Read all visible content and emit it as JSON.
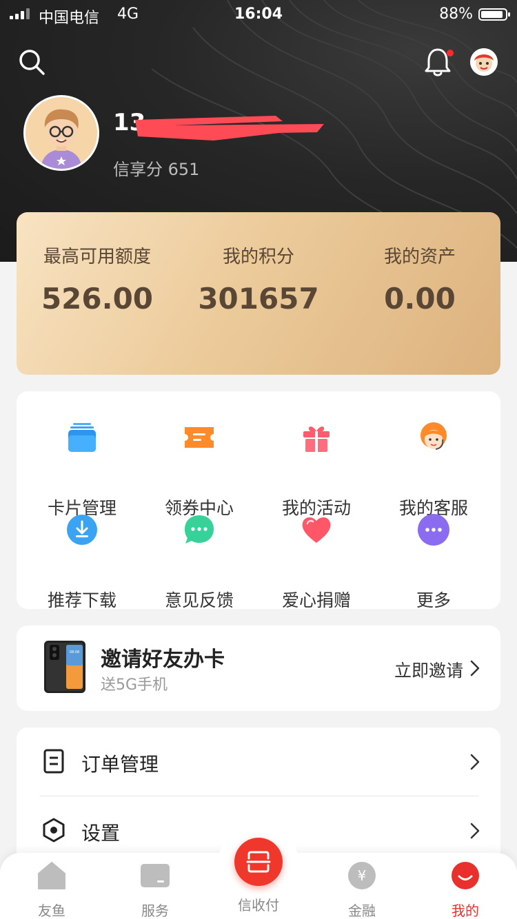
{
  "status": {
    "carrier": "中国电信",
    "network": "4G",
    "time": "16:04",
    "battery": "88%"
  },
  "profile": {
    "phone_prefix": "13",
    "credit_label": "信享分",
    "credit_value": "651"
  },
  "card": {
    "stats": [
      {
        "label": "最高可用额度",
        "value": "526.00"
      },
      {
        "label": "我的积分",
        "value": "301657"
      },
      {
        "label": "我的资产",
        "value": "0.00"
      }
    ]
  },
  "grid": [
    {
      "label": "卡片管理",
      "icon": "card-icon"
    },
    {
      "label": "领券中心",
      "icon": "coupon-icon"
    },
    {
      "label": "我的活动",
      "icon": "gift-icon"
    },
    {
      "label": "我的客服",
      "icon": "service-agent-icon"
    },
    {
      "label": "推荐下载",
      "icon": "download-icon"
    },
    {
      "label": "意见反馈",
      "icon": "feedback-icon"
    },
    {
      "label": "爱心捐赠",
      "icon": "heart-icon"
    },
    {
      "label": "更多",
      "icon": "more-icon"
    }
  ],
  "invite": {
    "title": "邀请好友办卡",
    "subtitle": "送5G手机",
    "cta": "立即邀请"
  },
  "menu": [
    {
      "label": "订单管理",
      "icon": "order-icon"
    },
    {
      "label": "设置",
      "icon": "settings-icon"
    }
  ],
  "tabs": [
    {
      "label": "友鱼",
      "icon": "home-icon"
    },
    {
      "label": "服务",
      "icon": "service-icon"
    },
    {
      "label": "信收付",
      "icon": "scan-pay-icon"
    },
    {
      "label": "金融",
      "icon": "finance-icon"
    },
    {
      "label": "我的",
      "icon": "me-icon"
    }
  ],
  "colors": {
    "accent": "#e8312c",
    "gold_start": "#f8e3c2",
    "gold_end": "#dcb27e",
    "header": "#222222"
  }
}
